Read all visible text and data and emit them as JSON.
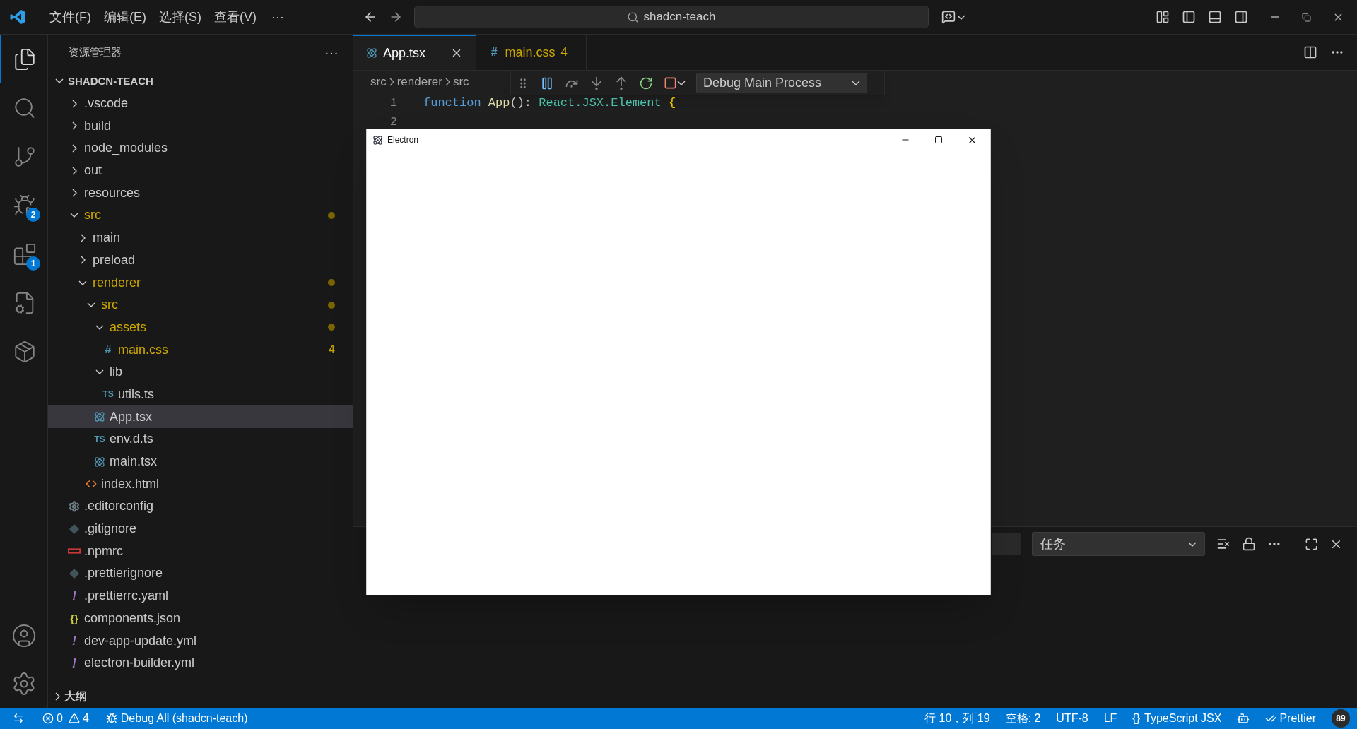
{
  "title_bar": {
    "menus": [
      "文件(F)",
      "编辑(E)",
      "选择(S)",
      "查看(V)"
    ],
    "more": "···",
    "search": {
      "value": "shadcn-teach"
    }
  },
  "activity_bar": {
    "items": [
      {
        "kind": "explorer",
        "selected": true
      },
      {
        "kind": "search",
        "selected": false
      },
      {
        "kind": "source-control",
        "selected": false
      },
      {
        "kind": "run-debug",
        "selected": false,
        "badge": "2"
      },
      {
        "kind": "extensions",
        "selected": false,
        "badge": "1"
      },
      {
        "kind": "remote",
        "selected": false
      },
      {
        "kind": "package",
        "selected": false
      }
    ],
    "bottom": [
      {
        "kind": "account"
      },
      {
        "kind": "settings"
      }
    ]
  },
  "sidebar": {
    "title": "资源管理器",
    "more": "···",
    "root": {
      "label": "SHADCN-TEACH",
      "expanded": true
    },
    "tree": [
      {
        "label": ".vscode",
        "kind": "folder",
        "expanded": false,
        "modified": false,
        "selected": false
      },
      {
        "label": "build",
        "kind": "folder",
        "expanded": false,
        "modified": false,
        "selected": false
      },
      {
        "label": "node_modules",
        "kind": "folder",
        "expanded": false,
        "modified": false,
        "selected": false
      },
      {
        "label": "out",
        "kind": "folder",
        "expanded": false,
        "modified": false,
        "selected": false
      },
      {
        "label": "resources",
        "kind": "folder",
        "expanded": false,
        "modified": false,
        "selected": false
      },
      {
        "label": "src",
        "kind": "folder",
        "expanded": true,
        "modified": true,
        "selected": false,
        "children": [
          {
            "label": "main",
            "kind": "folder",
            "expanded": false,
            "modified": false,
            "selected": false
          },
          {
            "label": "preload",
            "kind": "folder",
            "expanded": false,
            "modified": false,
            "selected": false
          },
          {
            "label": "renderer",
            "kind": "folder",
            "expanded": true,
            "modified": true,
            "selected": false,
            "children": [
              {
                "label": "src",
                "kind": "folder",
                "expanded": true,
                "modified": true,
                "selected": false,
                "children": [
                  {
                    "label": "assets",
                    "kind": "folder",
                    "expanded": true,
                    "modified": true,
                    "selected": false,
                    "children": [
                      {
                        "label": "main.css",
                        "kind": "css",
                        "icon_text": "#",
                        "modified": true,
                        "badge": "4",
                        "selected": false
                      }
                    ]
                  },
                  {
                    "label": "lib",
                    "kind": "folder",
                    "expanded": true,
                    "modified": false,
                    "selected": false,
                    "children": [
                      {
                        "label": "utils.ts",
                        "kind": "ts",
                        "icon_text": "TS",
                        "modified": false,
                        "selected": false
                      }
                    ]
                  },
                  {
                    "label": "App.tsx",
                    "kind": "react",
                    "modified": false,
                    "selected": true
                  },
                  {
                    "label": "env.d.ts",
                    "kind": "ts",
                    "icon_text": "TS",
                    "modified": false,
                    "selected": false
                  },
                  {
                    "label": "main.tsx",
                    "kind": "react",
                    "modified": false,
                    "selected": false
                  }
                ]
              },
              {
                "label": "index.html",
                "kind": "html",
                "modified": false,
                "selected": false
              }
            ]
          }
        ]
      },
      {
        "label": ".editorconfig",
        "kind": "gear",
        "modified": false,
        "selected": false
      },
      {
        "label": ".gitignore",
        "kind": "git",
        "modified": false,
        "selected": false
      },
      {
        "label": ".npmrc",
        "kind": "npm",
        "modified": false,
        "selected": false
      },
      {
        "label": ".prettierignore",
        "kind": "git",
        "modified": false,
        "selected": false
      },
      {
        "label": ".prettierrc.yaml",
        "kind": "yaml",
        "icon_text": "!",
        "modified": false,
        "selected": false
      },
      {
        "label": "components.json",
        "kind": "json",
        "icon_text": "{}",
        "modified": false,
        "selected": false
      },
      {
        "label": "dev-app-update.yml",
        "kind": "yaml",
        "icon_text": "!",
        "modified": false,
        "selected": false
      },
      {
        "label": "electron-builder.yml",
        "kind": "yaml",
        "icon_text": "!",
        "modified": false,
        "selected": false
      }
    ],
    "outline": {
      "label": "大纲",
      "expanded": false
    }
  },
  "tabs": [
    {
      "label": "App.tsx",
      "kind": "react",
      "selected": true,
      "modified": false
    },
    {
      "label": "main.css",
      "kind": "css",
      "icon_text": "#",
      "selected": false,
      "modified": true,
      "badge": "4"
    }
  ],
  "breadcrumb": [
    "src",
    "renderer",
    "src"
  ],
  "debug_toolbar": {
    "config": "Debug Main Process"
  },
  "code": [
    {
      "number": "1",
      "tokens": [
        {
          "kind": "keyword",
          "text": "function"
        },
        {
          "kind": "function",
          "text": " App"
        },
        {
          "kind": "plain",
          "text": "(): "
        },
        {
          "kind": "type",
          "text": "React.JSX.Element"
        },
        {
          "kind": "bracket",
          "text": " {"
        }
      ]
    },
    {
      "number": "2"
    }
  ],
  "electron_window": {
    "title": "Electron"
  },
  "panel": {
    "task_select": "任务"
  },
  "status_bar": {
    "errors": "0",
    "warnings": "4",
    "debug": "Debug All (shadcn-teach)",
    "cursor": "行 10，列 19",
    "indent": "空格: 2",
    "encoding": "UTF-8",
    "eol": "LF",
    "language_icon": "{}",
    "language": "TypeScript JSX",
    "formatter": "Prettier",
    "badge": "89"
  }
}
